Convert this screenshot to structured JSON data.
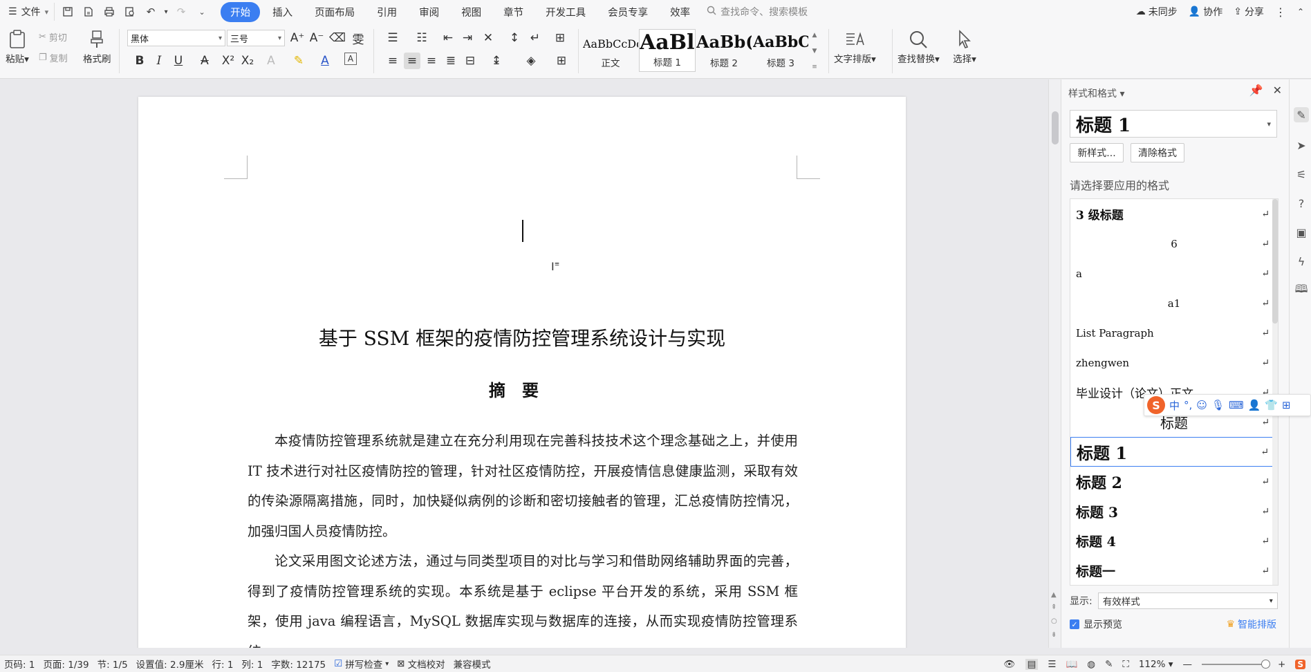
{
  "menubar": {
    "file_label": "文件",
    "tabs": [
      "开始",
      "插入",
      "页面布局",
      "引用",
      "审阅",
      "视图",
      "章节",
      "开发工具",
      "会员专享",
      "效率"
    ],
    "active_tab": "开始",
    "search_placeholder": "查找命令、搜索模板",
    "sync_label": "未同步",
    "collab_label": "协作",
    "share_label": "分享"
  },
  "ribbon": {
    "paste_label": "粘贴",
    "cut_label": "剪切",
    "copy_label": "复制",
    "format_painter_label": "格式刷",
    "font_name": "黑体",
    "font_size": "三号",
    "styles": [
      {
        "preview": "AaBbCcDd",
        "label": "正文"
      },
      {
        "preview": "AaBl",
        "label": "标题 1"
      },
      {
        "preview": "AaBb(",
        "label": "标题 2"
      },
      {
        "preview": "AaBbC",
        "label": "标题 3"
      }
    ],
    "text_layout_label": "文字排版",
    "find_replace_label": "查找替换",
    "select_label": "选择"
  },
  "document": {
    "title": "基于 SSM 框架的疫情防控管理系统设计与实现",
    "abstract_heading": "摘要",
    "paragraphs": [
      "本疫情防控管理系统就是建立在充分利用现在完善科技技术这个理念基础之上，并使用 IT 技术进行对社区疫情防控的管理，针对社区疫情防控，开展疫情信息健康监测，采取有效的传染源隔离措施，同时，加快疑似病例的诊断和密切接触者的管理，汇总疫情防控情况，加强归国人员疫情防控。",
      "论文采用图文论述方法，通过与同类型项目的对比与学习和借助网络辅助界面的完善，得到了疫情防控管理系统的实现。本系统是基于 eclipse 平台开发的系统，采用 SSM 框架，使用 java 编程语言，MySQL 数据库实现与数据库的连接，从而实现疫情防控管理系统。"
    ]
  },
  "panel": {
    "title": "样式和格式",
    "current_style": "标题 1",
    "new_style_label": "新样式...",
    "clear_format_label": "清除格式",
    "hint": "请选择要应用的格式",
    "styles": [
      {
        "name": "3 级标题",
        "size": 17,
        "bold": true,
        "align": "left"
      },
      {
        "name": "6",
        "size": 15,
        "bold": false,
        "align": "center"
      },
      {
        "name": "a",
        "size": 15,
        "bold": false,
        "align": "left"
      },
      {
        "name": "a1",
        "size": 15,
        "bold": false,
        "align": "center"
      },
      {
        "name": "List Paragraph",
        "size": 15,
        "bold": false,
        "align": "left"
      },
      {
        "name": "zhengwen",
        "size": 15,
        "bold": false,
        "align": "left"
      },
      {
        "name": "毕业设计（论文）正文",
        "size": 17,
        "bold": false,
        "align": "left"
      },
      {
        "name": "标题",
        "size": 20,
        "bold": false,
        "align": "center"
      },
      {
        "name": "标题 1",
        "size": 24,
        "bold": true,
        "align": "left"
      },
      {
        "name": "标题 2",
        "size": 22,
        "bold": true,
        "align": "left"
      },
      {
        "name": "标题 3",
        "size": 20,
        "bold": true,
        "align": "left"
      },
      {
        "name": "标题 4",
        "size": 19,
        "bold": true,
        "align": "left"
      },
      {
        "name": "标题一",
        "size": 19,
        "bold": true,
        "align": "left"
      }
    ],
    "selected_style": "标题 1",
    "show_label": "显示:",
    "show_value": "有效样式",
    "preview_label": "显示预览",
    "smart_layout_label": "智能排版"
  },
  "ime": {
    "logo": "S",
    "lang": "中"
  },
  "status": {
    "page_code": "页码: 1",
    "page": "页面: 1/39",
    "section": "节: 1/5",
    "setting": "设置值: 2.9厘米",
    "row": "行: 1",
    "col": "列: 1",
    "word_count": "字数: 12175",
    "spellcheck": "拼写检查",
    "proofread": "文档校对",
    "compat": "兼容模式",
    "zoom": "112%"
  }
}
